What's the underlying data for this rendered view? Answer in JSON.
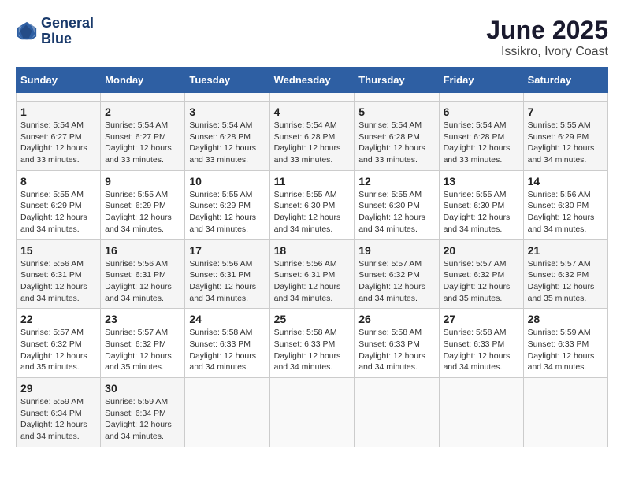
{
  "header": {
    "logo_line1": "General",
    "logo_line2": "Blue",
    "title": "June 2025",
    "subtitle": "Issikro, Ivory Coast"
  },
  "calendar": {
    "days_of_week": [
      "Sunday",
      "Monday",
      "Tuesday",
      "Wednesday",
      "Thursday",
      "Friday",
      "Saturday"
    ],
    "weeks": [
      [
        {
          "day": "",
          "info": ""
        },
        {
          "day": "",
          "info": ""
        },
        {
          "day": "",
          "info": ""
        },
        {
          "day": "",
          "info": ""
        },
        {
          "day": "",
          "info": ""
        },
        {
          "day": "",
          "info": ""
        },
        {
          "day": "",
          "info": ""
        }
      ],
      [
        {
          "day": "1",
          "info": "Sunrise: 5:54 AM\nSunset: 6:27 PM\nDaylight: 12 hours\nand 33 minutes."
        },
        {
          "day": "2",
          "info": "Sunrise: 5:54 AM\nSunset: 6:27 PM\nDaylight: 12 hours\nand 33 minutes."
        },
        {
          "day": "3",
          "info": "Sunrise: 5:54 AM\nSunset: 6:28 PM\nDaylight: 12 hours\nand 33 minutes."
        },
        {
          "day": "4",
          "info": "Sunrise: 5:54 AM\nSunset: 6:28 PM\nDaylight: 12 hours\nand 33 minutes."
        },
        {
          "day": "5",
          "info": "Sunrise: 5:54 AM\nSunset: 6:28 PM\nDaylight: 12 hours\nand 33 minutes."
        },
        {
          "day": "6",
          "info": "Sunrise: 5:54 AM\nSunset: 6:28 PM\nDaylight: 12 hours\nand 33 minutes."
        },
        {
          "day": "7",
          "info": "Sunrise: 5:55 AM\nSunset: 6:29 PM\nDaylight: 12 hours\nand 34 minutes."
        }
      ],
      [
        {
          "day": "8",
          "info": "Sunrise: 5:55 AM\nSunset: 6:29 PM\nDaylight: 12 hours\nand 34 minutes."
        },
        {
          "day": "9",
          "info": "Sunrise: 5:55 AM\nSunset: 6:29 PM\nDaylight: 12 hours\nand 34 minutes."
        },
        {
          "day": "10",
          "info": "Sunrise: 5:55 AM\nSunset: 6:29 PM\nDaylight: 12 hours\nand 34 minutes."
        },
        {
          "day": "11",
          "info": "Sunrise: 5:55 AM\nSunset: 6:30 PM\nDaylight: 12 hours\nand 34 minutes."
        },
        {
          "day": "12",
          "info": "Sunrise: 5:55 AM\nSunset: 6:30 PM\nDaylight: 12 hours\nand 34 minutes."
        },
        {
          "day": "13",
          "info": "Sunrise: 5:55 AM\nSunset: 6:30 PM\nDaylight: 12 hours\nand 34 minutes."
        },
        {
          "day": "14",
          "info": "Sunrise: 5:56 AM\nSunset: 6:30 PM\nDaylight: 12 hours\nand 34 minutes."
        }
      ],
      [
        {
          "day": "15",
          "info": "Sunrise: 5:56 AM\nSunset: 6:31 PM\nDaylight: 12 hours\nand 34 minutes."
        },
        {
          "day": "16",
          "info": "Sunrise: 5:56 AM\nSunset: 6:31 PM\nDaylight: 12 hours\nand 34 minutes."
        },
        {
          "day": "17",
          "info": "Sunrise: 5:56 AM\nSunset: 6:31 PM\nDaylight: 12 hours\nand 34 minutes."
        },
        {
          "day": "18",
          "info": "Sunrise: 5:56 AM\nSunset: 6:31 PM\nDaylight: 12 hours\nand 34 minutes."
        },
        {
          "day": "19",
          "info": "Sunrise: 5:57 AM\nSunset: 6:32 PM\nDaylight: 12 hours\nand 34 minutes."
        },
        {
          "day": "20",
          "info": "Sunrise: 5:57 AM\nSunset: 6:32 PM\nDaylight: 12 hours\nand 35 minutes."
        },
        {
          "day": "21",
          "info": "Sunrise: 5:57 AM\nSunset: 6:32 PM\nDaylight: 12 hours\nand 35 minutes."
        }
      ],
      [
        {
          "day": "22",
          "info": "Sunrise: 5:57 AM\nSunset: 6:32 PM\nDaylight: 12 hours\nand 35 minutes."
        },
        {
          "day": "23",
          "info": "Sunrise: 5:57 AM\nSunset: 6:32 PM\nDaylight: 12 hours\nand 35 minutes."
        },
        {
          "day": "24",
          "info": "Sunrise: 5:58 AM\nSunset: 6:33 PM\nDaylight: 12 hours\nand 34 minutes."
        },
        {
          "day": "25",
          "info": "Sunrise: 5:58 AM\nSunset: 6:33 PM\nDaylight: 12 hours\nand 34 minutes."
        },
        {
          "day": "26",
          "info": "Sunrise: 5:58 AM\nSunset: 6:33 PM\nDaylight: 12 hours\nand 34 minutes."
        },
        {
          "day": "27",
          "info": "Sunrise: 5:58 AM\nSunset: 6:33 PM\nDaylight: 12 hours\nand 34 minutes."
        },
        {
          "day": "28",
          "info": "Sunrise: 5:59 AM\nSunset: 6:33 PM\nDaylight: 12 hours\nand 34 minutes."
        }
      ],
      [
        {
          "day": "29",
          "info": "Sunrise: 5:59 AM\nSunset: 6:34 PM\nDaylight: 12 hours\nand 34 minutes."
        },
        {
          "day": "30",
          "info": "Sunrise: 5:59 AM\nSunset: 6:34 PM\nDaylight: 12 hours\nand 34 minutes."
        },
        {
          "day": "",
          "info": ""
        },
        {
          "day": "",
          "info": ""
        },
        {
          "day": "",
          "info": ""
        },
        {
          "day": "",
          "info": ""
        },
        {
          "day": "",
          "info": ""
        }
      ]
    ]
  }
}
